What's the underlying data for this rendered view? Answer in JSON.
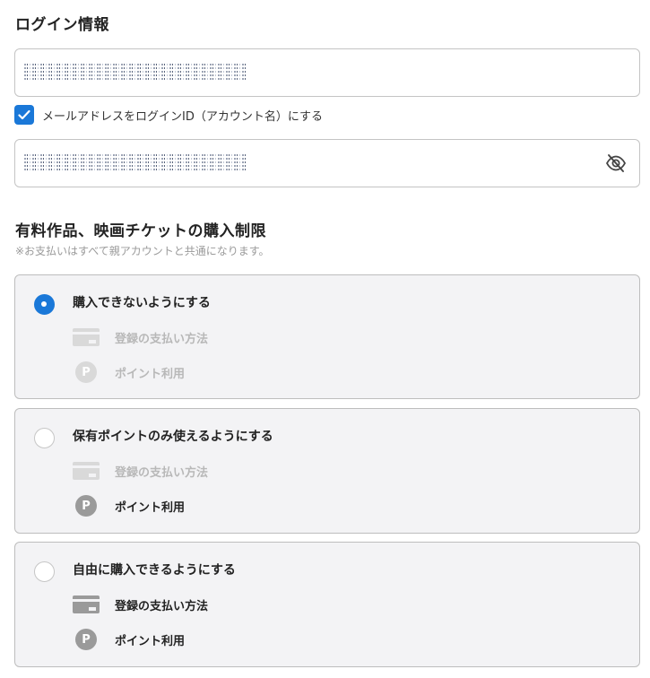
{
  "login": {
    "title": "ログイン情報",
    "use_email_label": "メールアドレスをログインID（アカウント名）にする",
    "use_email_checked": true,
    "password_visibility_icon": "eye-off-icon"
  },
  "purchase": {
    "title": "有料作品、映画チケットの購入制限",
    "note": "※お支払いはすべて親アカウントと共通になります。",
    "options": [
      {
        "label": "購入できないようにする",
        "selected": true,
        "methods": [
          {
            "label": "登録の支払い方法",
            "icon": "credit-card-icon",
            "enabled": false
          },
          {
            "label": "ポイント利用",
            "icon": "point-icon",
            "enabled": false
          }
        ]
      },
      {
        "label": "保有ポイントのみ使えるようにする",
        "selected": false,
        "methods": [
          {
            "label": "登録の支払い方法",
            "icon": "credit-card-icon",
            "enabled": false
          },
          {
            "label": "ポイント利用",
            "icon": "point-icon",
            "enabled": true
          }
        ]
      },
      {
        "label": "自由に購入できるようにする",
        "selected": false,
        "methods": [
          {
            "label": "登録の支払い方法",
            "icon": "credit-card-icon",
            "enabled": true
          },
          {
            "label": "ポイント利用",
            "icon": "point-icon",
            "enabled": true
          }
        ]
      }
    ]
  },
  "icons": {
    "point_glyph": "P"
  },
  "colors": {
    "accent": "#1a78d8",
    "card_bg": "#f3f3f5",
    "disabled_text": "#b8b8b8"
  }
}
